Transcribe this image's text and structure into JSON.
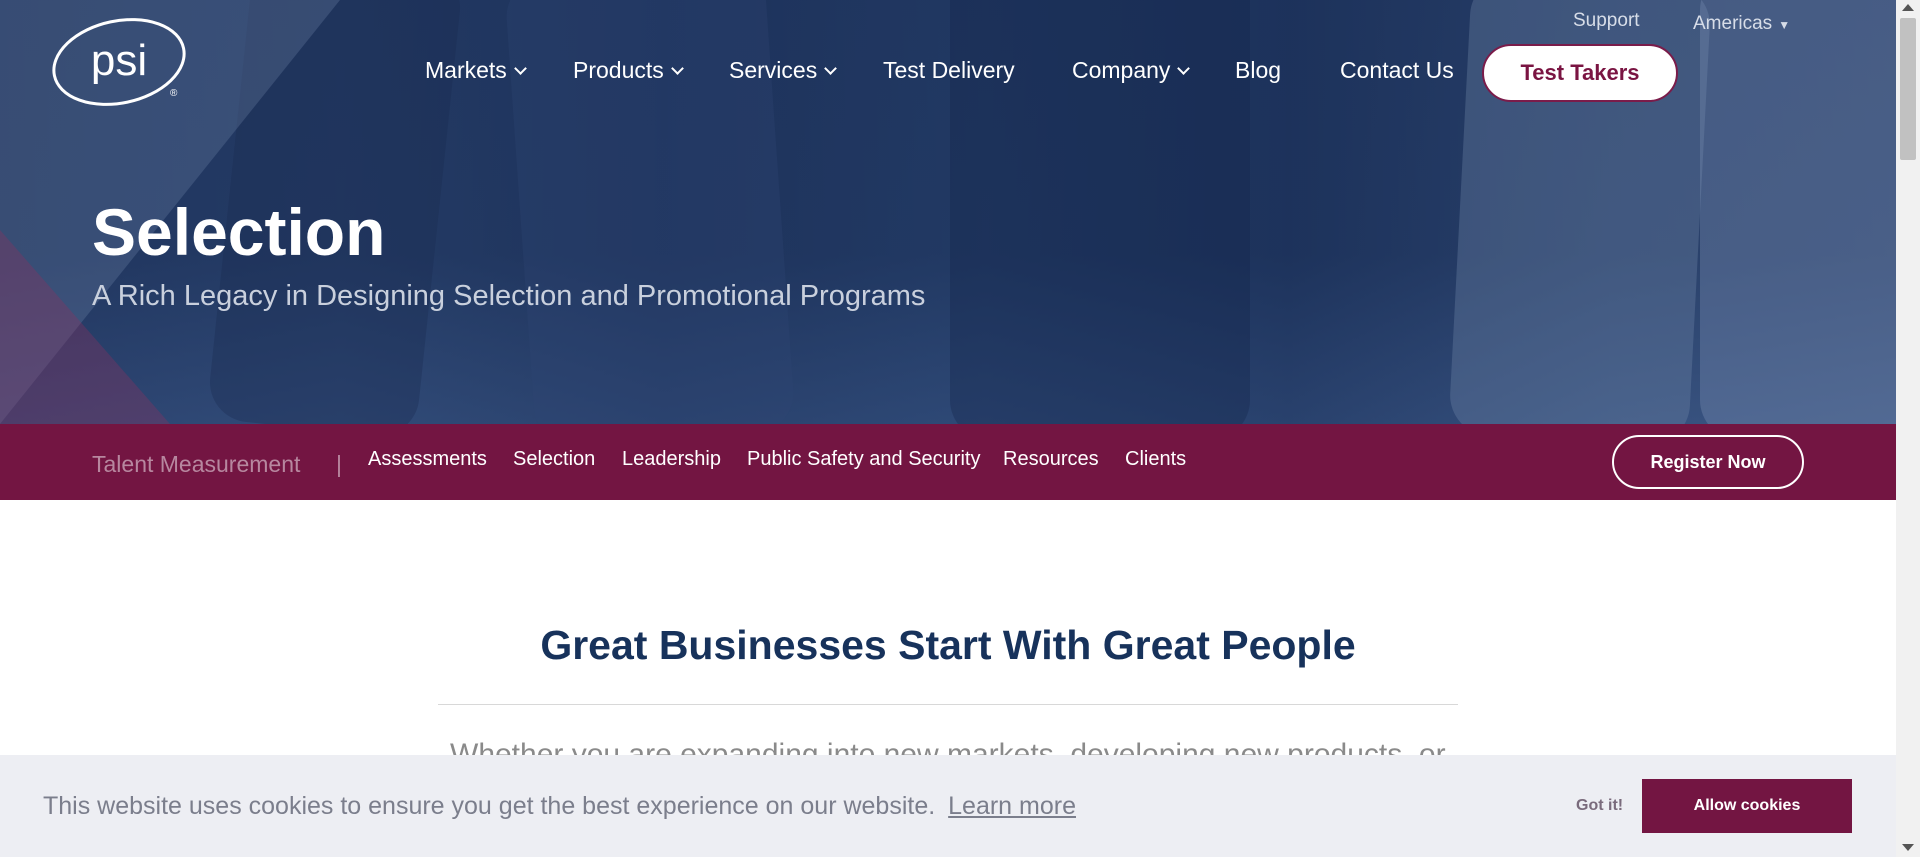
{
  "brand": {
    "logo_text": "psi",
    "registered": "®"
  },
  "utility_nav": {
    "support": "Support",
    "region": "Americas",
    "region_caret": "▼"
  },
  "main_nav": {
    "items": [
      {
        "label": "Markets",
        "dropdown": true
      },
      {
        "label": "Products",
        "dropdown": true
      },
      {
        "label": "Services",
        "dropdown": true
      },
      {
        "label": "Test Delivery",
        "dropdown": false
      },
      {
        "label": "Company",
        "dropdown": true
      },
      {
        "label": "Blog",
        "dropdown": false
      },
      {
        "label": "Contact Us",
        "dropdown": false
      }
    ],
    "cta_label": "Test Takers"
  },
  "hero": {
    "title": "Selection",
    "subtitle": "A Rich Legacy in Designing Selection and Promotional Programs"
  },
  "section_nav": {
    "section_label": "Talent Measurement",
    "separator": "|",
    "links": [
      "Assessments",
      "Selection",
      "Leadership",
      "Public Safety and Security",
      "Resources",
      "Clients"
    ],
    "register_label": "Register Now"
  },
  "content": {
    "heading": "Great Businesses Start With Great People",
    "paragraph_start": "Whether you are expanding into new markets, developing new products, or"
  },
  "cookie_banner": {
    "message": "This website uses cookies to ensure you get the best experience on our website.",
    "learn_more": "Learn more",
    "dismiss_label": "Got it!",
    "allow_label": "Allow cookies"
  },
  "colors": {
    "brand_primary": "#731542",
    "hero_overlay": "#1c315a",
    "heading_text": "#17325b"
  }
}
